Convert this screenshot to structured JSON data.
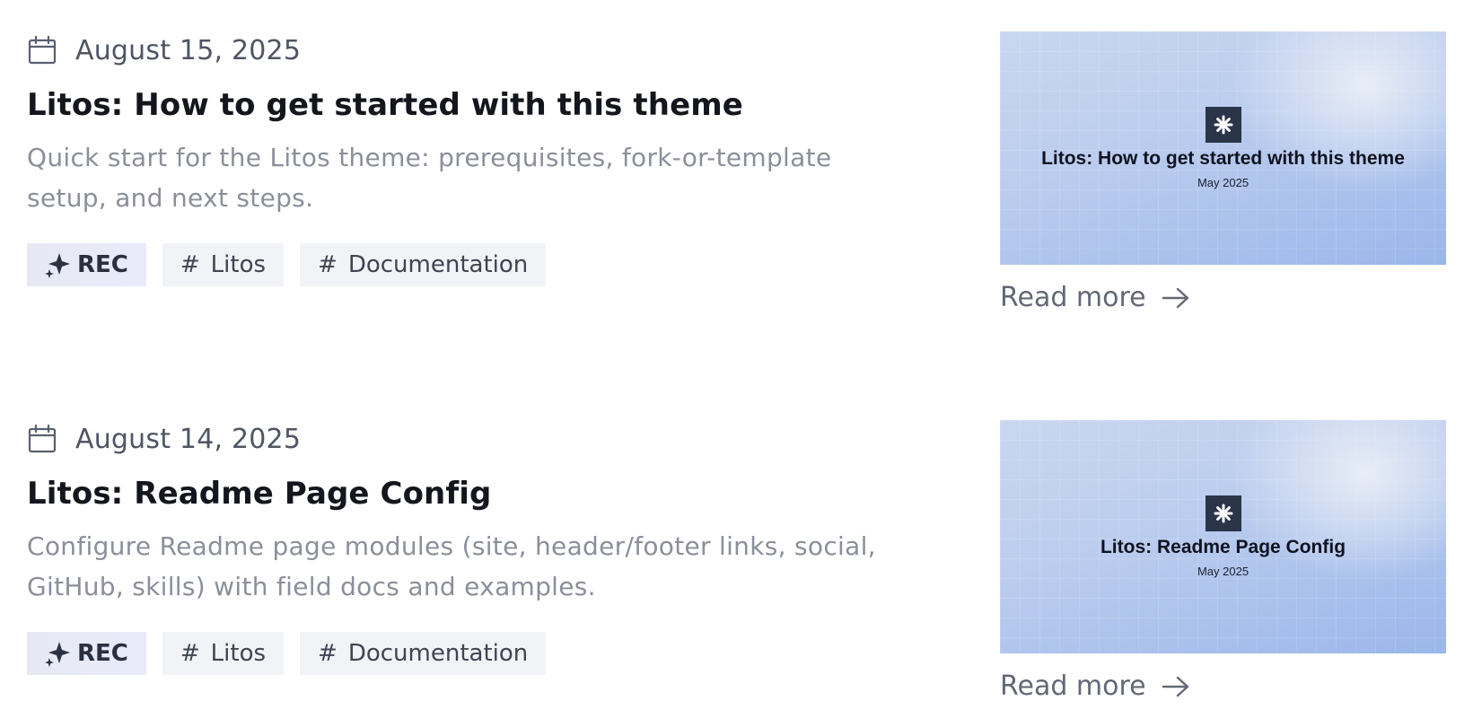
{
  "posts": [
    {
      "date": "August 15, 2025",
      "title": "Litos: How to get started with this theme",
      "description": "Quick start for the Litos theme: prerequisites, fork-or-template setup, and next steps.",
      "tags": [
        {
          "label": "REC",
          "icon": "sparkle-icon",
          "variant": "recommended"
        },
        {
          "label": "Litos",
          "icon": "hash-icon",
          "variant": "tag"
        },
        {
          "label": "Documentation",
          "icon": "hash-icon",
          "variant": "tag"
        }
      ],
      "thumbnail": {
        "title": "Litos: How to get started with this theme",
        "date": "May 2025",
        "logo_icon": "asterisk-icon"
      },
      "read_more": "Read more"
    },
    {
      "date": "August 14, 2025",
      "title": "Litos: Readme Page Config",
      "description": "Configure Readme page modules (site, header/footer links, social, GitHub, skills) with field docs and examples.",
      "tags": [
        {
          "label": "REC",
          "icon": "sparkle-icon",
          "variant": "recommended"
        },
        {
          "label": "Litos",
          "icon": "hash-icon",
          "variant": "tag"
        },
        {
          "label": "Documentation",
          "icon": "hash-icon",
          "variant": "tag"
        }
      ],
      "thumbnail": {
        "title": "Litos: Readme Page Config",
        "date": "May 2025",
        "logo_icon": "asterisk-icon"
      },
      "read_more": "Read more"
    }
  ],
  "colors": {
    "title": "#14161d",
    "description": "#8a8f99",
    "tag_bg": "#f2f3f6",
    "thumb_logo_bg": "#2b3548",
    "thumb_gradient_start": "#c9d7ef",
    "thumb_gradient_end": "#9ab6ea"
  }
}
